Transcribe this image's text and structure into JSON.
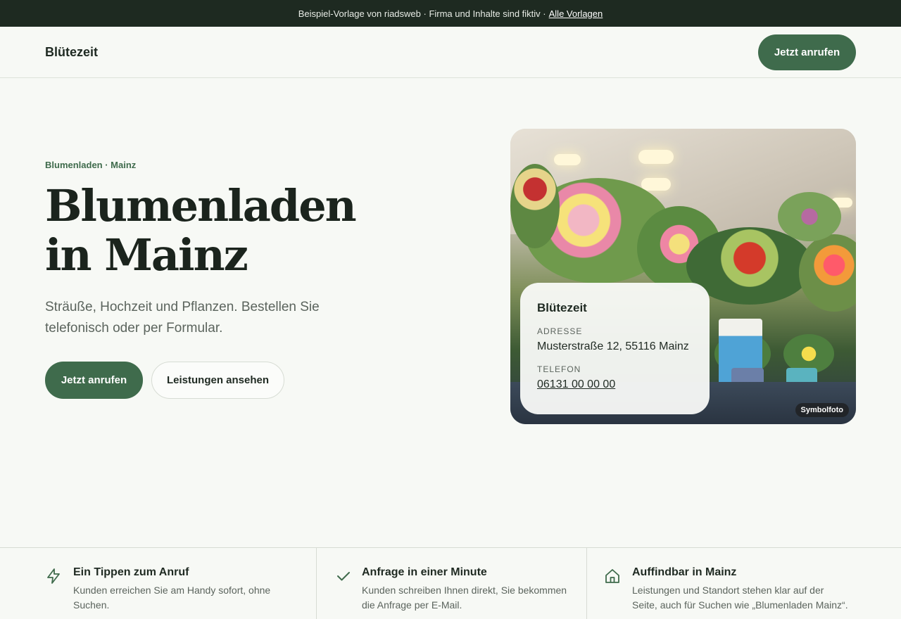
{
  "topbar": {
    "text": "Beispiel-Vorlage von riadsweb · Firma und Inhalte sind fiktiv ·",
    "link": "Alle Vorlagen"
  },
  "header": {
    "brand": "Blütezeit",
    "call_label": "Jetzt anrufen"
  },
  "hero": {
    "eyebrow": "Blumenladen · Mainz",
    "title_line1": "Blumenladen",
    "title_line2": "in Mainz",
    "subtitle": "Sträuße, Hochzeit und Pflanzen. Bestellen Sie telefonisch oder per Formular.",
    "primary_label": "Jetzt anrufen",
    "secondary_label": "Leistungen ansehen"
  },
  "photo": {
    "tag": "Symbolfoto"
  },
  "info_card": {
    "name": "Blütezeit",
    "address_label": "ADRESSE",
    "address": "Musterstraße 12, 55116 Mainz",
    "phone_label": "TELEFON",
    "phone": "06131 00 00 00"
  },
  "features": [
    {
      "icon": "lightning-icon",
      "title": "Ein Tippen zum Anruf",
      "desc": "Kunden erreichen Sie am Handy sofort, ohne Suchen."
    },
    {
      "icon": "check-icon",
      "title": "Anfrage in einer Minute",
      "desc": "Kunden schreiben Ihnen direkt, Sie bekommen die Anfrage per E-Mail."
    },
    {
      "icon": "home-icon",
      "title": "Auffindbar in Mainz",
      "desc": "Leistungen und Standort stehen klar auf der Seite, auch für Suchen wie „Blumenladen Mainz“."
    }
  ],
  "colors": {
    "accent": "#3f6b4c",
    "topbar_bg": "#1e2a21",
    "page_bg": "#f7f9f5"
  }
}
